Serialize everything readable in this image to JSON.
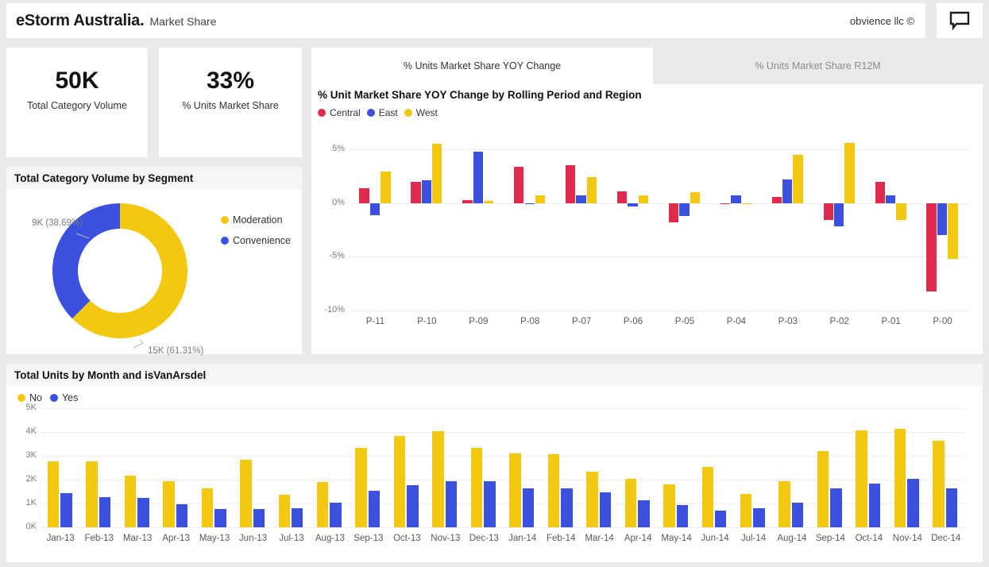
{
  "header": {
    "brand_name": "eStorm Australia.",
    "brand_sub": "Market Share",
    "copyright": "obvience llc ©",
    "comment_icon": "comment-icon"
  },
  "kpis": [
    {
      "value": "50K",
      "label": "Total Category Volume"
    },
    {
      "value": "33%",
      "label": "% Units Market Share"
    }
  ],
  "donut_panel": {
    "title": "Total Category Volume by Segment"
  },
  "tabs": [
    {
      "label": "% Units Market Share YOY Change",
      "active": true
    },
    {
      "label": "% Units Market Share R12M",
      "active": false
    }
  ],
  "colors": {
    "red": "#e02b4c",
    "blue": "#3c50e0",
    "yellow": "#f2c811",
    "page_bg": "#eaeaea",
    "panel_bg": "#ffffff",
    "header_bg": "#f6f6f6",
    "gridline": "#ededed"
  },
  "chart_data": [
    {
      "type": "pie",
      "title": "Total Category Volume by Segment",
      "legend_position": "right",
      "labels": [
        "Moderation",
        "Convenience"
      ],
      "values": [
        15,
        9
      ],
      "value_labels": [
        "15K (61.31%)",
        "9K\n(38.69%)"
      ],
      "percents": [
        61.31,
        38.69
      ],
      "colors": [
        "#f2c811",
        "#3c50e0"
      ],
      "annotations": [
        "9K (38.69%)",
        "15K (61.31%)"
      ]
    },
    {
      "type": "bar",
      "title": "% Unit Market Share YOY Change by Rolling Period and Region",
      "xlabel": "",
      "ylabel": "",
      "ylim": [
        -10,
        7
      ],
      "yticks": [
        5,
        0,
        -5,
        -10
      ],
      "ytick_labels": [
        "5%",
        "0%",
        "-5%",
        "-10%"
      ],
      "grid": true,
      "legend_position": "top-left",
      "categories": [
        "P-11",
        "P-10",
        "P-09",
        "P-08",
        "P-07",
        "P-06",
        "P-05",
        "P-04",
        "P-03",
        "P-02",
        "P-01",
        "P-00"
      ],
      "series": [
        {
          "name": "Central",
          "color": "#e02b4c",
          "values": [
            1.4,
            2.0,
            0.25,
            3.4,
            3.5,
            1.1,
            -1.8,
            -0.05,
            0.6,
            -1.6,
            2.0,
            -8.2
          ]
        },
        {
          "name": "East",
          "color": "#3c50e0",
          "values": [
            -1.1,
            2.1,
            4.75,
            -0.05,
            0.7,
            -0.35,
            -1.2,
            0.75,
            2.2,
            -2.2,
            0.75,
            -3.0
          ]
        },
        {
          "name": "West",
          "color": "#f2c811",
          "values": [
            2.9,
            5.5,
            0.2,
            0.7,
            2.4,
            0.7,
            1.0,
            -0.05,
            4.5,
            5.6,
            -1.6,
            -5.2
          ]
        }
      ]
    },
    {
      "type": "bar",
      "title": "Total Units by Month and isVanArsdel",
      "xlabel": "",
      "ylabel": "",
      "ylim": [
        0,
        5
      ],
      "yticks": [
        5,
        4,
        3,
        2,
        1,
        0
      ],
      "ytick_labels": [
        "5K",
        "4K",
        "3K",
        "2K",
        "1K",
        "0K"
      ],
      "grid": true,
      "legend_position": "top-left",
      "categories": [
        "Jan-13",
        "Feb-13",
        "Mar-13",
        "Apr-13",
        "May-13",
        "Jun-13",
        "Jul-13",
        "Aug-13",
        "Sep-13",
        "Oct-13",
        "Nov-13",
        "Dec-13",
        "Jan-14",
        "Feb-14",
        "Mar-14",
        "Apr-14",
        "May-14",
        "Jun-14",
        "Jul-14",
        "Aug-14",
        "Sep-14",
        "Oct-14",
        "Nov-14",
        "Dec-14"
      ],
      "series": [
        {
          "name": "No",
          "color": "#f2c811",
          "values": [
            2.78,
            2.78,
            2.17,
            1.93,
            1.65,
            2.85,
            1.38,
            1.9,
            3.33,
            3.85,
            4.05,
            3.33,
            3.1,
            3.08,
            2.33,
            2.05,
            1.8,
            2.55,
            1.4,
            1.93,
            3.2,
            4.08,
            4.12,
            3.62
          ]
        },
        {
          "name": "Yes",
          "color": "#3c50e0",
          "values": [
            1.42,
            1.27,
            1.23,
            0.98,
            0.77,
            0.78,
            0.8,
            1.02,
            1.55,
            1.77,
            1.95,
            1.95,
            1.65,
            1.65,
            1.48,
            1.12,
            0.92,
            0.7,
            0.8,
            1.05,
            1.65,
            1.85,
            2.02,
            1.65
          ]
        }
      ]
    }
  ]
}
